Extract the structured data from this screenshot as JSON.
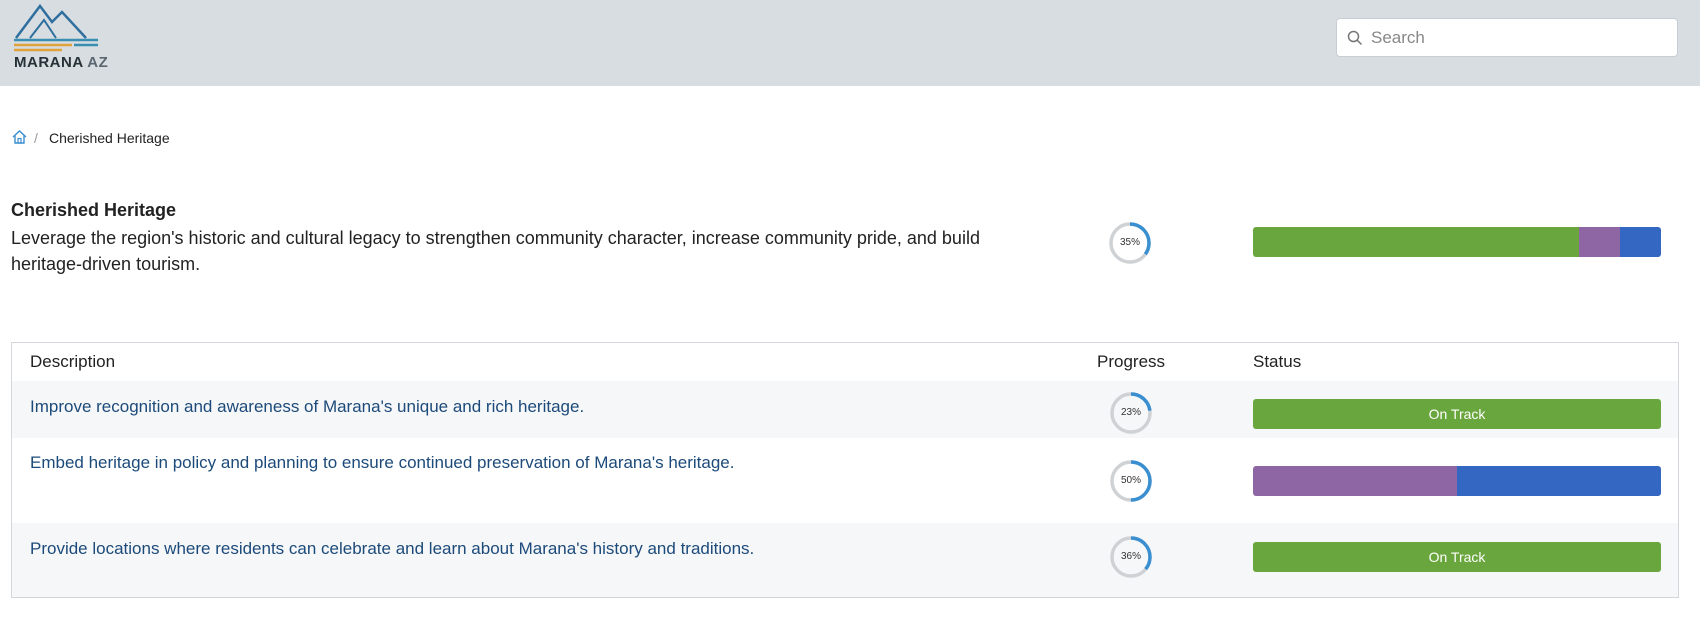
{
  "header": {
    "logo": {
      "name": "MARANA",
      "suffix": "AZ",
      "icon": "mountain-logo-icon"
    },
    "search": {
      "placeholder": "Search",
      "icon": "search-icon"
    }
  },
  "breadcrumb": {
    "home_icon": "home-icon",
    "separator": "/",
    "current": "Cherished Heritage"
  },
  "goal": {
    "title": "Cherished Heritage",
    "description": "Leverage the region's historic and cultural legacy to strengthen community character, increase community pride, and build heritage-driven tourism.",
    "progress": 35,
    "progress_label": "35%",
    "status_breakdown": [
      {
        "status": "On Track",
        "fraction": 0.8,
        "color": "#6aa63e"
      },
      {
        "status": "purple",
        "fraction": 0.1,
        "color": "#8e66a3"
      },
      {
        "status": "blue",
        "fraction": 0.1,
        "color": "#3467c1"
      }
    ]
  },
  "table": {
    "columns": {
      "description": "Description",
      "progress": "Progress",
      "status": "Status"
    },
    "rows": [
      {
        "description": "Improve recognition and awareness of Marana's unique and rich heritage.",
        "progress": 23,
        "progress_label": "23%",
        "status": "On Track"
      },
      {
        "description": "Embed heritage in policy and planning to ensure continued preservation of Marana's heritage.",
        "progress": 50,
        "progress_label": "50%",
        "status_breakdown": [
          {
            "fraction": 0.5,
            "color": "#8e66a3"
          },
          {
            "fraction": 0.5,
            "color": "#3467c1"
          }
        ]
      },
      {
        "description": "Provide locations where residents can celebrate and learn about Marana's history and traditions.",
        "progress": 36,
        "progress_label": "36%",
        "status": "On Track"
      }
    ]
  },
  "colors": {
    "header_bg": "#d8dde2",
    "link": "#1c4a7a",
    "on_track": "#6aa63e",
    "purple": "#8e66a3",
    "blue": "#3467c1",
    "ring_track": "#cfd2d5",
    "ring_fill": "#3a8fd1"
  }
}
